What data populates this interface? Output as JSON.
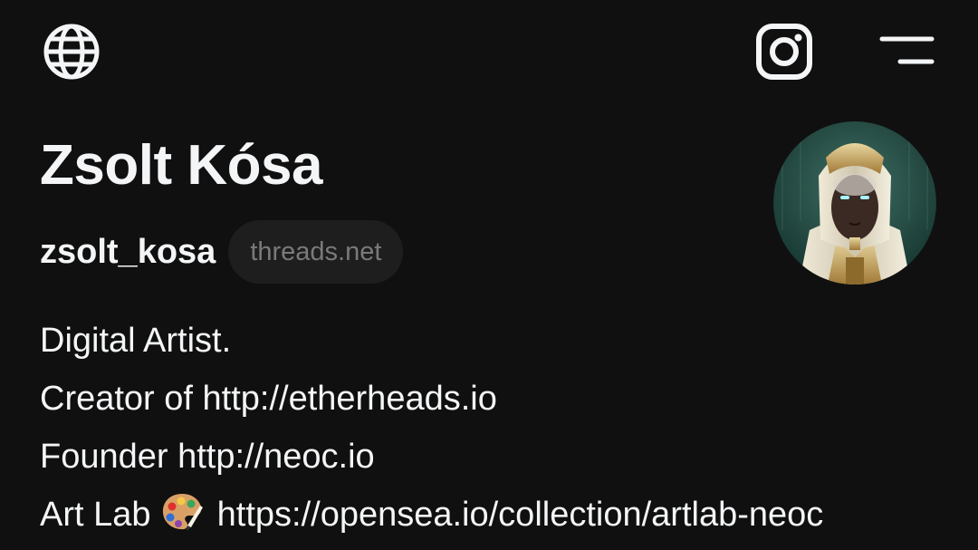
{
  "header": {
    "globe_icon": "globe-icon",
    "instagram_icon": "instagram-icon",
    "menu_icon": "menu-icon"
  },
  "profile": {
    "name": "Zsolt Kósa",
    "username": "zsolt_kosa",
    "domain_badge": "threads.net",
    "avatar_icon": "avatar"
  },
  "bio": {
    "line1": "Digital Artist.",
    "line2": "Creator of http://etherheads.io",
    "line3": "Founder http://neoc.io",
    "line4_prefix": "Art Lab ",
    "line4_emoji_icon": "artist-palette-icon",
    "line4_suffix": " https://opensea.io/collection/artlab-neoc"
  },
  "colors": {
    "background": "#101010",
    "text": "#f3f5f7",
    "badge_background": "#1e1e1e",
    "badge_text": "#7a7a7a"
  }
}
